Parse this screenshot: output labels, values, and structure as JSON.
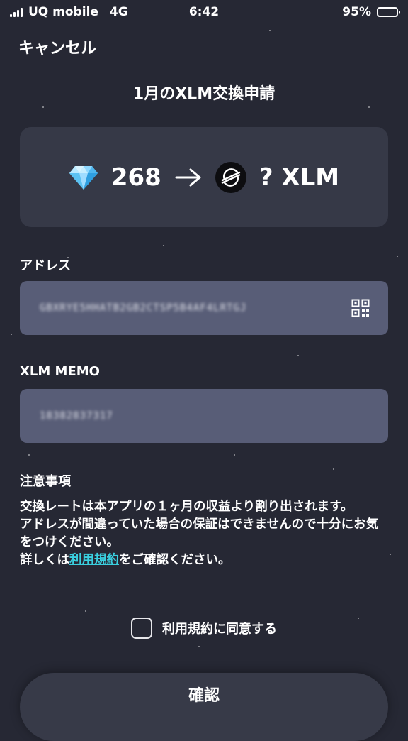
{
  "status_bar": {
    "carrier": "UQ mobile",
    "network": "4G",
    "time": "6:42",
    "battery_percent": "95%",
    "battery_level": 0.95
  },
  "header": {
    "cancel_label": "キャンセル",
    "title": "1月のXLM交換申請"
  },
  "exchange": {
    "gem_icon": "diamond-icon",
    "gems": "268",
    "arrow_icon": "arrow-right-icon",
    "coin_icon": "stellar-logo-icon",
    "xlm_amount": "? XLM"
  },
  "address": {
    "label": "アドレス",
    "value": "GBXRYE5HHATB2GB2CTSP5B4AF4LRTGJ",
    "qr_icon": "qr-code-icon"
  },
  "memo": {
    "label": "XLM MEMO",
    "value": "18382837317"
  },
  "notes": {
    "title": "注意事項",
    "line1": "交換レートは本アプリの１ヶ月の収益より割り出されます。",
    "line2": "アドレスが間違っていた場合の保証はできませんので十分にお気をつけください。",
    "line3_prefix": "詳しくは",
    "line3_link": "利用規約",
    "line3_suffix": "をご確認ください。",
    "link_color": "#3ad0e0"
  },
  "agreement": {
    "label": "利用規約に同意する",
    "checked": false
  },
  "confirm_label": "確認",
  "colors": {
    "background": "#262834",
    "card": "#363947",
    "field": "#585d77",
    "accent": "#3ad0e0"
  }
}
